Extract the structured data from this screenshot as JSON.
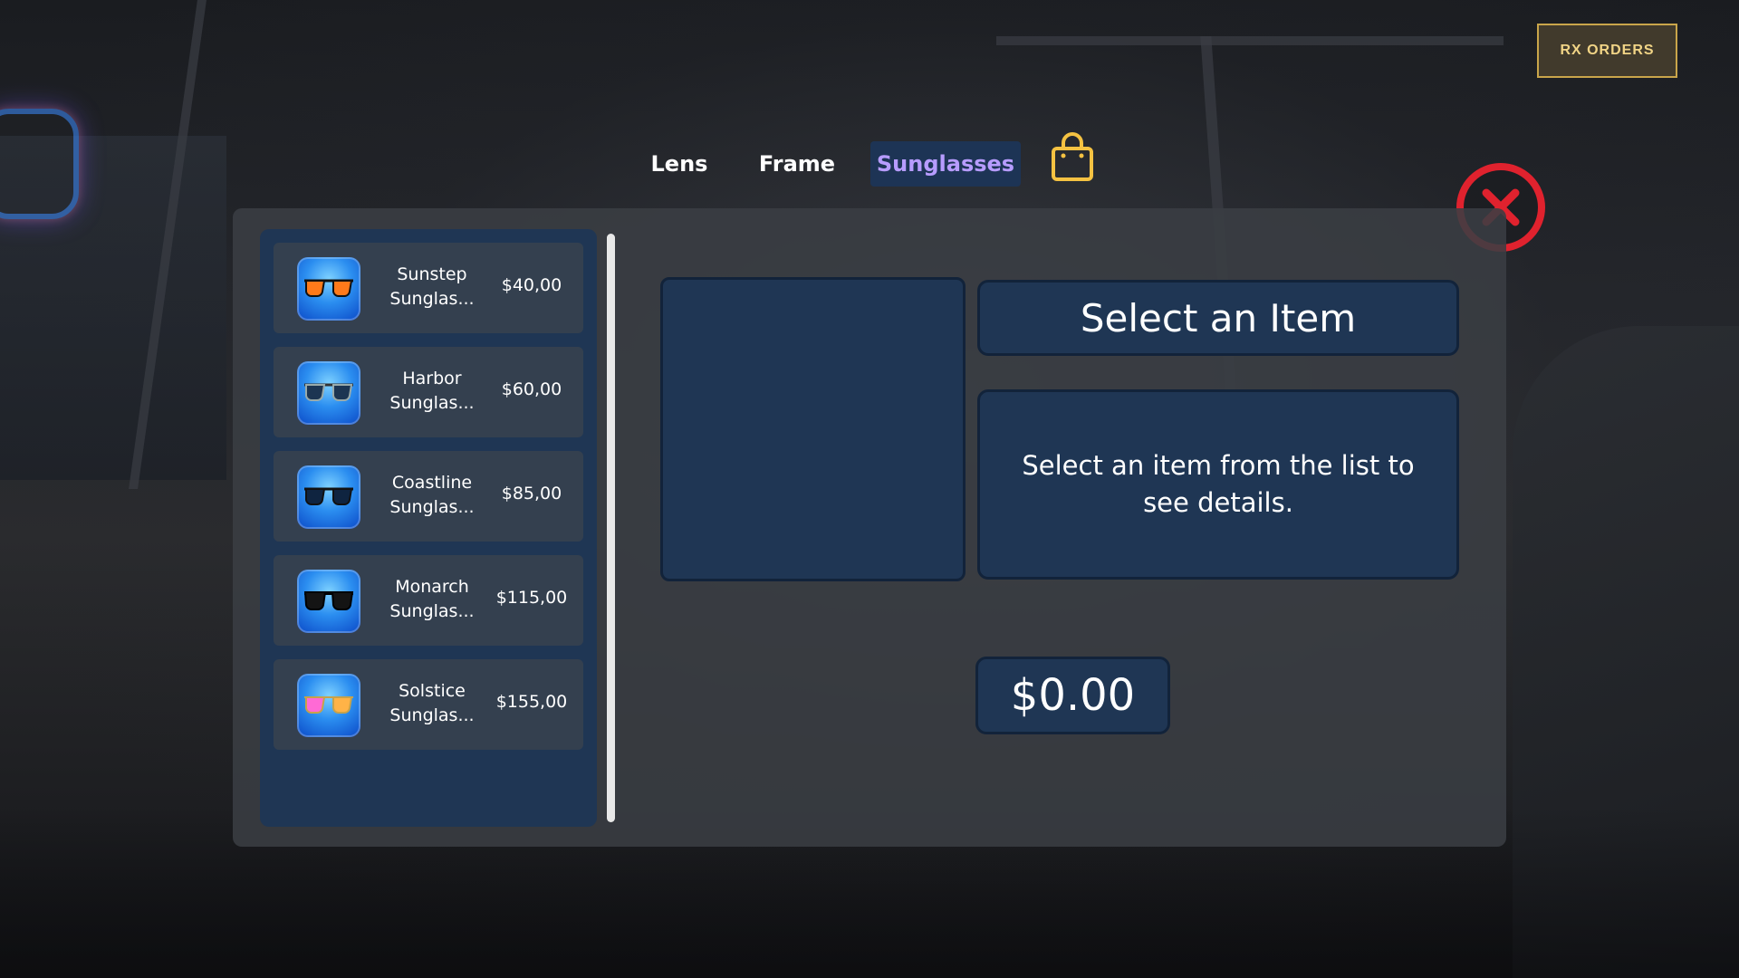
{
  "header": {
    "rx_orders_label": "RX ORDERS"
  },
  "tabs": [
    {
      "label": "Lens",
      "active": false
    },
    {
      "label": "Frame",
      "active": false
    },
    {
      "label": "Sunglasses",
      "active": true
    }
  ],
  "icons": {
    "cart": "shopping-bag-icon",
    "close": "close-icon"
  },
  "colors": {
    "accent_gold": "#f5c242",
    "active_tab_text": "#b79cff",
    "panel_blue": "#1f3654",
    "close_red": "#e0222e"
  },
  "items": [
    {
      "name": "Sunstep Sunglas...",
      "price": "$40,00",
      "lens_color": "#ff7a1a"
    },
    {
      "name": "Harbor Sunglas...",
      "price": "$60,00",
      "lens_color": "#1c3552"
    },
    {
      "name": "Coastline Sunglas...",
      "price": "$85,00",
      "lens_color": "#0f2440"
    },
    {
      "name": "Monarch Sunglas...",
      "price": "$115,00",
      "lens_color": "#141414"
    },
    {
      "name": "Solstice Sunglas...",
      "price": "$155,00",
      "lens_color": "#ff6ad5"
    }
  ],
  "details": {
    "title": "Select an Item",
    "description": "Select an item from the list to see details.",
    "price": "$0.00"
  }
}
